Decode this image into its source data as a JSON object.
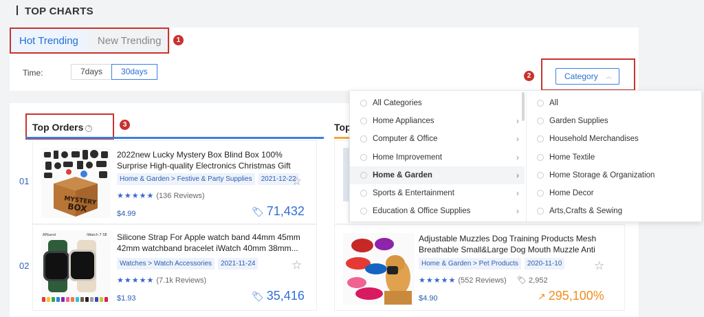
{
  "page": {
    "title": "TOP CHARTS"
  },
  "tabs": [
    {
      "label": "Hot Trending"
    },
    {
      "label": "New Trending"
    }
  ],
  "time": {
    "label": "Time:",
    "options": [
      "7days",
      "30days"
    ],
    "selected": "30days"
  },
  "category": {
    "label": "Category"
  },
  "badges": [
    "1",
    "2",
    "3"
  ],
  "columns": {
    "top_orders": "Top Orders",
    "second": "Top"
  },
  "dropdown": {
    "left": [
      {
        "label": "All Categories",
        "arrow": false
      },
      {
        "label": "Home Appliances",
        "arrow": true
      },
      {
        "label": "Computer & Office",
        "arrow": true
      },
      {
        "label": "Home Improvement",
        "arrow": true
      },
      {
        "label": "Home & Garden",
        "arrow": true
      },
      {
        "label": "Sports & Entertainment",
        "arrow": true
      },
      {
        "label": "Education & Office Supplies",
        "arrow": true
      }
    ],
    "right": [
      {
        "label": "All"
      },
      {
        "label": "Garden Supplies"
      },
      {
        "label": "Household Merchandises"
      },
      {
        "label": "Home Textile"
      },
      {
        "label": "Home Storage & Organization"
      },
      {
        "label": "Home Decor"
      },
      {
        "label": "Arts,Crafts & Sewing"
      }
    ]
  },
  "top_orders": [
    {
      "rank": "01",
      "title": "2022new Lucky Mystery Box Blind Box 100% Surprise High-quality Electronics Christmas Gift Novelty...",
      "category_tag": "Home & Garden > Festive & Party Supplies",
      "date": "2021-12-22",
      "stars": "★★★★★",
      "reviews": "(136 Reviews)",
      "price": "$4.99",
      "orders": "71,432"
    },
    {
      "rank": "02",
      "title": "Silicone Strap For Apple watch band 44mm 45mm 42mm watchband bracelet iWatch 40mm 38mm...",
      "category_tag": "Watches > Watch Accessories",
      "date": "2021-11-24",
      "stars": "★★★★★",
      "reviews": "(7.1k Reviews)",
      "price": "$1.93",
      "orders": "35,416"
    }
  ],
  "second_column": [
    {
      "title": "Adjustable Muzzles Dog Training Products Mesh Breathable Small&Large Dog Mouth Muzzle Anti Bar...",
      "category_tag": "Home & Garden > Pet Products",
      "date": "2020-11-10",
      "stars": "★★★★★",
      "reviews": "(552 Reviews)",
      "views": "2,952",
      "price": "$4.90",
      "growth": "295,100%"
    }
  ],
  "colors": {
    "accent": "#1e6fd9",
    "annotation": "#c8322d",
    "growth": "#f08c1c"
  }
}
